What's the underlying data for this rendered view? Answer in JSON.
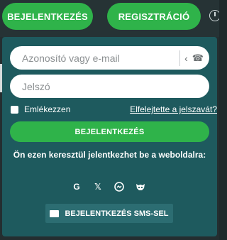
{
  "header": {
    "login_button": "BEJELENTKEZÉS",
    "register_button": "REGISZTRÁCIÓ"
  },
  "login_panel": {
    "identifier_placeholder": "Azonosító vagy e-mail",
    "password_placeholder": "Jelszó",
    "remember_label": "Emlékezzen",
    "forgot_link": "Elfelejtette a jelszavát?",
    "submit_label": "BEJELENTKEZÉS",
    "social_title": "Ön ezen keresztül jelentkezhet be a weboldalra:",
    "social_icons": [
      "google-icon",
      "x-icon",
      "messenger-icon",
      "mask-icon"
    ],
    "sms_button": "BEJELENTKEZÉS SMS-SEL"
  },
  "colors": {
    "accent": "#2fb34a",
    "panel": "#1e5a5e",
    "sms_button": "#2c6d72"
  }
}
